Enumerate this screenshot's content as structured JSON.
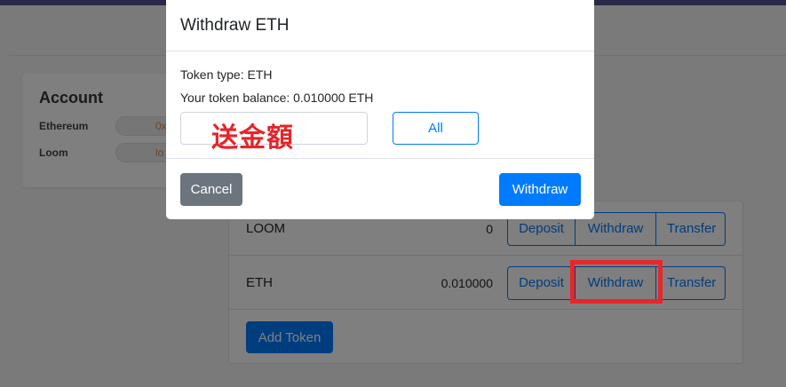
{
  "account": {
    "title": "Account",
    "rows": [
      {
        "label": "Ethereum",
        "value": "0x"
      },
      {
        "label": "Loom",
        "value": "lo"
      }
    ]
  },
  "tokens": {
    "rows": [
      {
        "name": "LOOM",
        "amount": "0",
        "deposit_label": "Deposit",
        "withdraw_label": "Withdraw",
        "transfer_label": "Transfer"
      },
      {
        "name": "ETH",
        "amount": "0.010000",
        "deposit_label": "Deposit",
        "withdraw_label": "Withdraw",
        "transfer_label": "Transfer"
      }
    ],
    "add_token_label": "Add Token"
  },
  "modal": {
    "title": "Withdraw ETH",
    "token_type": "Token type: ETH",
    "balance": "Your token balance: 0.010000 ETH",
    "amount_annotation": "送金額",
    "all_label": "All",
    "cancel_label": "Cancel",
    "withdraw_label": "Withdraw"
  },
  "colors": {
    "primary": "#007bff",
    "secondary": "#6c757d",
    "annotation_red": "#e8262a",
    "topbar": "#51508f"
  }
}
